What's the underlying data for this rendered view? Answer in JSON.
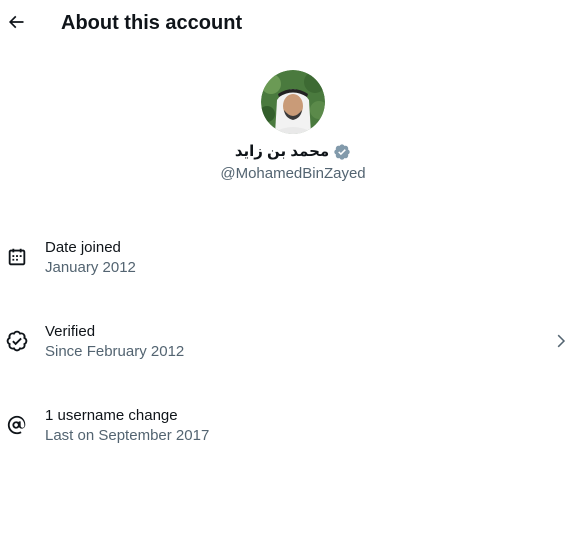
{
  "header": {
    "title": "About this account",
    "back_icon": "arrow-left-icon"
  },
  "profile": {
    "display_name": "محمد بن زايد",
    "handle": "@MohamedBinZayed",
    "verified_color": "#829aab",
    "avatar_bg": "#4a7a3e"
  },
  "info": [
    {
      "icon": "calendar-icon",
      "label": "Date joined",
      "sub": "January 2012"
    },
    {
      "icon": "verified-icon",
      "label": "Verified",
      "sub": "Since February 2012",
      "has_chevron": true
    },
    {
      "icon": "at-sign-icon",
      "label": "1 username change",
      "sub": "Last on September 2017"
    }
  ]
}
